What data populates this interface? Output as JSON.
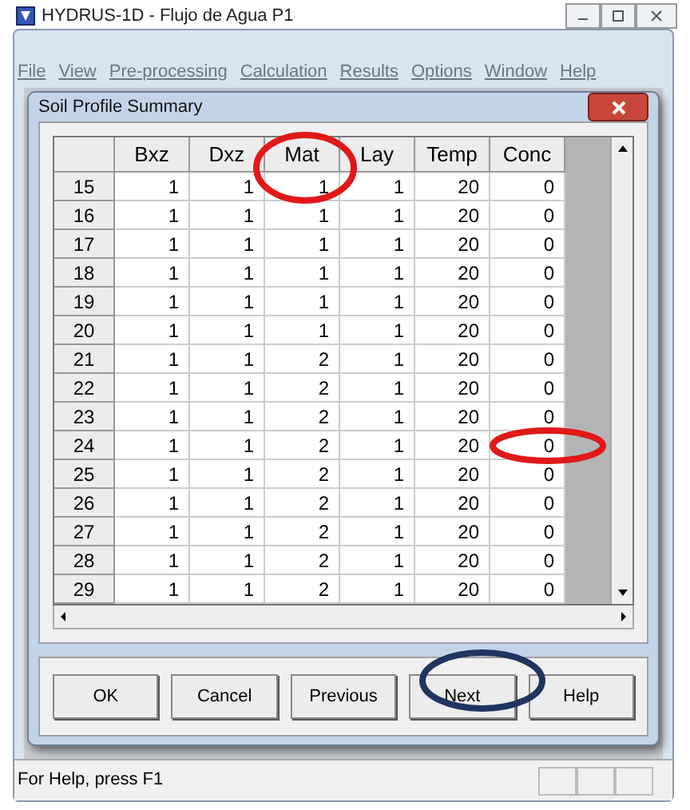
{
  "window": {
    "title": "HYDRUS-1D - Flujo de Agua P1"
  },
  "menu": [
    "File",
    "View",
    "Pre-processing",
    "Calculation",
    "Results",
    "Options",
    "Window",
    "Help"
  ],
  "dialog": {
    "title": "Soil Profile Summary",
    "table": {
      "columns": [
        "Bxz",
        "Dxz",
        "Mat",
        "Lay",
        "Temp",
        "Conc"
      ],
      "rows": [
        {
          "label": "15",
          "cells": [
            "1",
            "1",
            "1",
            "1",
            "20",
            "0"
          ]
        },
        {
          "label": "16",
          "cells": [
            "1",
            "1",
            "1",
            "1",
            "20",
            "0"
          ]
        },
        {
          "label": "17",
          "cells": [
            "1",
            "1",
            "1",
            "1",
            "20",
            "0"
          ]
        },
        {
          "label": "18",
          "cells": [
            "1",
            "1",
            "1",
            "1",
            "20",
            "0"
          ]
        },
        {
          "label": "19",
          "cells": [
            "1",
            "1",
            "1",
            "1",
            "20",
            "0"
          ]
        },
        {
          "label": "20",
          "cells": [
            "1",
            "1",
            "1",
            "1",
            "20",
            "0"
          ]
        },
        {
          "label": "21",
          "cells": [
            "1",
            "1",
            "2",
            "1",
            "20",
            "0"
          ]
        },
        {
          "label": "22",
          "cells": [
            "1",
            "1",
            "2",
            "1",
            "20",
            "0"
          ]
        },
        {
          "label": "23",
          "cells": [
            "1",
            "1",
            "2",
            "1",
            "20",
            "0"
          ]
        },
        {
          "label": "24",
          "cells": [
            "1",
            "1",
            "2",
            "1",
            "20",
            "0"
          ]
        },
        {
          "label": "25",
          "cells": [
            "1",
            "1",
            "2",
            "1",
            "20",
            "0"
          ]
        },
        {
          "label": "26",
          "cells": [
            "1",
            "1",
            "2",
            "1",
            "20",
            "0"
          ]
        },
        {
          "label": "27",
          "cells": [
            "1",
            "1",
            "2",
            "1",
            "20",
            "0"
          ]
        },
        {
          "label": "28",
          "cells": [
            "1",
            "1",
            "2",
            "1",
            "20",
            "0"
          ]
        },
        {
          "label": "29",
          "cells": [
            "1",
            "1",
            "2",
            "1",
            "20",
            "0"
          ]
        }
      ]
    },
    "buttons": [
      "OK",
      "Cancel",
      "Previous",
      "Next",
      "Help"
    ]
  },
  "annotations": [
    {
      "kind": "ellipse",
      "color": "#e01818"
    },
    {
      "kind": "ellipse",
      "color": "#e01818"
    },
    {
      "kind": "ellipse",
      "color": "#1f3560"
    }
  ],
  "status_bar": "For Help, press F1"
}
